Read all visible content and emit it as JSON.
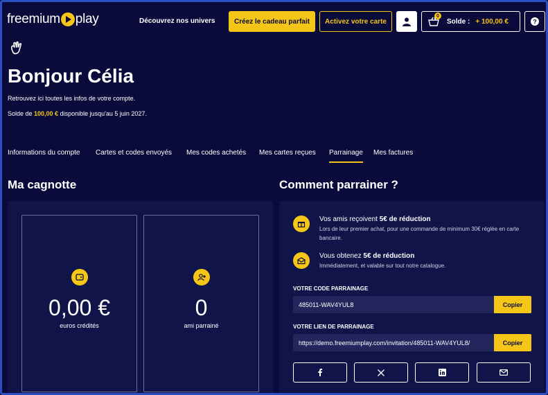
{
  "header": {
    "logo_left": "freemium",
    "logo_right": "play",
    "nav_univers": "Découvrez nos univers",
    "btn_gift": "Créez le cadeau parfait",
    "btn_activate": "Activez votre carte",
    "cart_badge": "0",
    "solde_label": "Solde :",
    "solde_amount": "+ 100,00 €",
    "help": "?"
  },
  "greeting": {
    "title": "Bonjour Célia",
    "intro": "Retrouvez ici toutes les infos de votre compte.",
    "solde_prefix": "Solde de ",
    "solde_amount": "100,00 €",
    "solde_suffix": " disponible jusqu'au 5 juin 2027."
  },
  "tabs": [
    {
      "label": "Informations du compte"
    },
    {
      "label": "Cartes et codes envoyés"
    },
    {
      "label": "Mes codes achetés"
    },
    {
      "label": "Mes cartes reçues"
    },
    {
      "label": "Parrainage",
      "active": true
    },
    {
      "label": "Mes factures"
    }
  ],
  "cagnotte": {
    "title": "Ma cagnotte",
    "credits_value": "0,00 €",
    "credits_label": "euros crédités",
    "friends_value": "0",
    "friends_label": "ami parrainé"
  },
  "parrainage": {
    "title": "Comment parrainer ?",
    "info1_title_prefix": "Vos amis reçoivent ",
    "info1_title_bold": "5€ de réduction",
    "info1_desc": "Lors de leur premier achat, pour une commande de minimum 30€ réglée en carte bancaire.",
    "info2_title_prefix": "Vous obtenez ",
    "info2_title_bold": "5€ de réduction",
    "info2_desc": "Immédiatement, et valable sur tout notre catalogue.",
    "code_label": "VOTRE CODE PARRAINAGE",
    "code_value": "485011-WAV4YUL8",
    "link_label": "VOTRE LIEN DE PARRAINAGE",
    "link_value": "https://demo.freemiumplay.com/invitation/485011-WAV4YUL8/",
    "copy_label": "Copier"
  },
  "colors": {
    "background": "#0a0b3a",
    "accent": "#f5c518",
    "panel": "#111449"
  }
}
